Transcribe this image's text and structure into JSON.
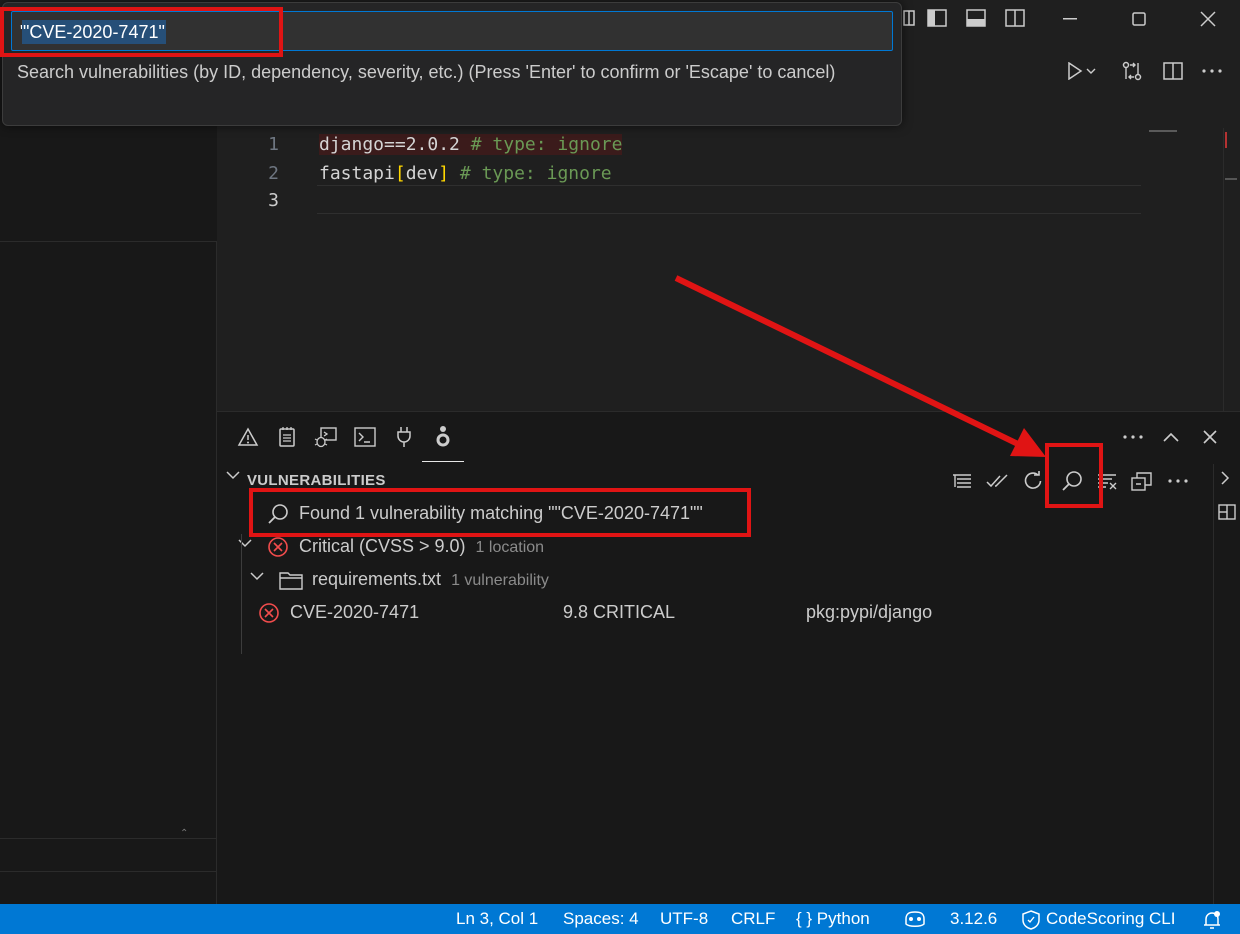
{
  "quick_input": {
    "value": "\"CVE-2020-7471\"",
    "message": "Search vulnerabilities (by ID, dependency, severity, etc.) (Press 'Enter' to confirm or 'Escape' to cancel)"
  },
  "editor": {
    "lines": [
      {
        "number": "1",
        "code": "django==2.0.2",
        "comment": "# type: ignore"
      },
      {
        "number": "2",
        "code_pre": "fastapi",
        "bracket_open": "[",
        "code_mid": "dev",
        "bracket_close": "]",
        "comment": "# type: ignore"
      },
      {
        "number": "3"
      }
    ]
  },
  "panel": {
    "view_title": "VULNERABILITIES",
    "search_result": "Found 1 vulnerability matching \"\"CVE-2020-7471\"\"",
    "tree": {
      "severity_group": {
        "label": "Critical (CVSS > 9.0)",
        "meta": "1 location"
      },
      "file": {
        "label": "requirements.txt",
        "meta": "1 vulnerability"
      },
      "vulnerability": {
        "id": "CVE-2020-7471",
        "score": "9.8 CRITICAL",
        "package": "pkg:pypi/django"
      }
    }
  },
  "statusbar": {
    "position": "Ln 3, Col 1",
    "spaces": "Spaces: 4",
    "encoding": "UTF-8",
    "eol": "CRLF",
    "language": "{ } Python",
    "python_version": "3.12.6",
    "codescoring": "CodeScoring CLI"
  },
  "colors": {
    "accent": "#0078d4",
    "error": "#f14c4c",
    "annotation": "#e01414"
  }
}
